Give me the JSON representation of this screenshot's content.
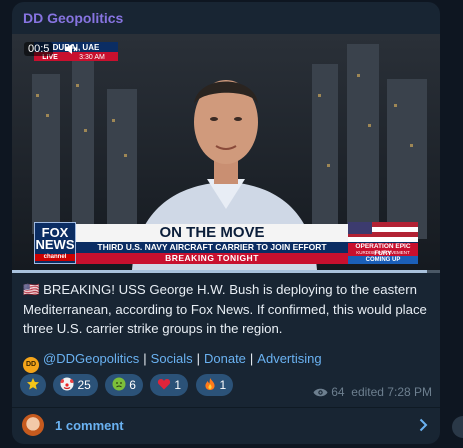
{
  "channel": {
    "name": "DD Geopolitics"
  },
  "video": {
    "time_overlay": "00:5",
    "location_tag": "DUBAI, UAE",
    "live_label": "LIVE",
    "clock": "3:30 AM",
    "network": "FOX",
    "network_line2": "NEWS",
    "network_sub": "channel",
    "headline": "ON THE MOVE",
    "subheadline": "THIRD U.S. NAVY AIRCRAFT CARRIER TO JOIN EFFORT",
    "ticker": "BREAKING TONIGHT",
    "side_title": "OPERATION EPIC FURY",
    "side_sub": "KURDISH INVOLVEMENT",
    "side_footer": "COMING UP",
    "progress": 0.97,
    "mute_icon": "speaker-muted-icon"
  },
  "message": {
    "flag": "🇺🇸",
    "text": "BREAKING! USS George H.W. Bush is deploying to the eastern Mediterranean, according to Fox News. If confirmed, this would place three U.S. carrier strike groups in the region."
  },
  "links": {
    "badge": "DD",
    "handle": "@DDGeopolitics",
    "items": [
      "Socials",
      "Donate",
      "Advertising"
    ],
    "separator": "|"
  },
  "reactions": [
    {
      "icon": "star-icon",
      "count": ""
    },
    {
      "icon": "clown-face-icon",
      "count": "25"
    },
    {
      "icon": "nauseated-face-icon",
      "count": "6"
    },
    {
      "icon": "heart-icon",
      "count": "1"
    },
    {
      "icon": "fire-icon",
      "count": "1"
    }
  ],
  "meta": {
    "views": "64",
    "edited": "edited 7:28 PM"
  },
  "comments": {
    "label": "1 comment"
  },
  "colors": {
    "background": "#0e1621",
    "bubble": "#182533",
    "accent": "#6ab2f2",
    "channel": "#8774e1"
  }
}
